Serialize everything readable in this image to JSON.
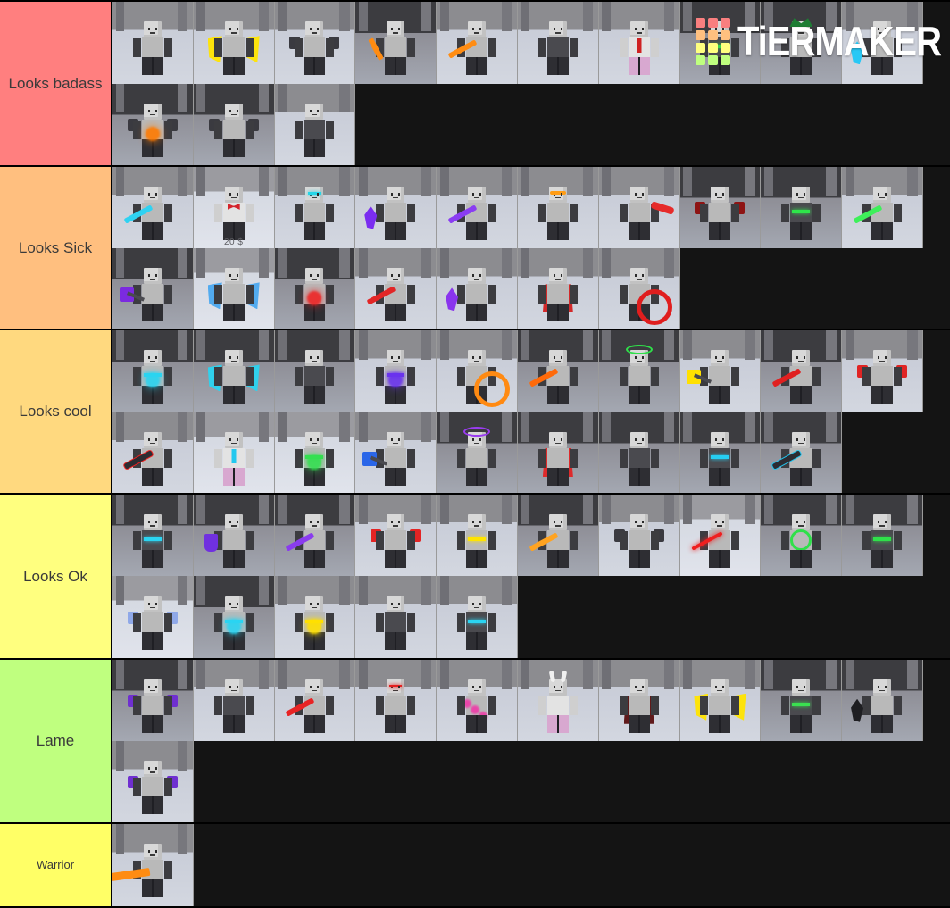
{
  "app": {
    "name": "TierMaker",
    "watermark_text": "TiERMAKER",
    "watermark_colors": [
      "#f97f7f",
      "#f97f7f",
      "#f97f7f",
      "#ffc07f",
      "#ffc07f",
      "#ffc07f",
      "#ffff7f",
      "#ffff7f",
      "#ffff7f",
      "#bfff7f",
      "#bfff7f",
      "#bfff7f"
    ]
  },
  "tiers": [
    {
      "label": "Looks badass",
      "color": "#ff7f7f",
      "count": 13,
      "items": [
        {
          "name": "gray-bot-with-dark-blaster",
          "accent": "#f2d000",
          "scene": "normal",
          "style": "blaster"
        },
        {
          "name": "yellow-energy-wings-bot",
          "accent": "#ffe400",
          "scene": "normal",
          "style": "wings"
        },
        {
          "name": "dark-armor-bot-yellow-gem",
          "accent": "#ffd400",
          "scene": "normal",
          "style": "shoulders"
        },
        {
          "name": "orange-arrow-slash-bot",
          "accent": "#ff8c12",
          "scene": "dark",
          "style": "slash"
        },
        {
          "name": "orange-blade-dark-bot",
          "accent": "#ff8c12",
          "scene": "normal",
          "style": "blade"
        },
        {
          "name": "plain-dark-armor-bot",
          "accent": "#6b6b72",
          "scene": "normal",
          "style": "plain"
        },
        {
          "name": "red-tie-suit-bot",
          "accent": "#cf2222",
          "scene": "normal",
          "style": "tie"
        },
        {
          "name": "green-trim-armor-bot",
          "accent": "#35d34a",
          "scene": "dark",
          "style": "trim"
        },
        {
          "name": "green-leaf-helm-bot",
          "accent": "#1e7d34",
          "scene": "dark",
          "style": "helm"
        },
        {
          "name": "cyan-crystal-bot",
          "accent": "#29c8f5",
          "scene": "normal",
          "style": "shard"
        },
        {
          "name": "orange-core-mech-bot",
          "accent": "#ff7a00",
          "scene": "dark",
          "style": "core"
        },
        {
          "name": "white-green-mech-bot",
          "accent": "#3ee35a",
          "scene": "dark",
          "style": "mech"
        },
        {
          "name": "gray-block-armor-bot",
          "accent": "#8b8b92",
          "scene": "normal",
          "style": "plain"
        }
      ]
    },
    {
      "label": "Looks Sick",
      "color": "#ffbf7f",
      "count": 17,
      "items": [
        {
          "name": "cyan-blade-bot",
          "accent": "#2fd2f2",
          "scene": "normal",
          "style": "blade"
        },
        {
          "name": "red-bowtie-butler-bot",
          "accent": "#d4232b",
          "scene": "bright",
          "style": "bowtie",
          "price": "20 $"
        },
        {
          "name": "cyan-eye-mech-bot",
          "accent": "#23d6e8",
          "scene": "normal",
          "style": "eyes"
        },
        {
          "name": "purple-gauntlet-bot",
          "accent": "#7a2df0",
          "scene": "normal",
          "style": "gauntlet"
        },
        {
          "name": "purple-blade-bot",
          "accent": "#8a3df2",
          "scene": "normal",
          "style": "blade"
        },
        {
          "name": "orange-visor-bot",
          "accent": "#ff9c14",
          "scene": "normal",
          "style": "visor"
        },
        {
          "name": "red-ribbon-mech-bot",
          "accent": "#e62b2b",
          "scene": "normal",
          "style": "ribbon"
        },
        {
          "name": "dark-red-armor-bot",
          "accent": "#8e1414",
          "scene": "dark",
          "style": "armor"
        },
        {
          "name": "green-trim-bot",
          "accent": "#2ee64a",
          "scene": "dark",
          "style": "trim"
        },
        {
          "name": "green-sword-bot",
          "accent": "#3ef05a",
          "scene": "normal",
          "style": "blade"
        },
        {
          "name": "purple-axe-bot",
          "accent": "#7b2ae0",
          "scene": "dark",
          "style": "axe"
        },
        {
          "name": "blue-energy-wings-bot",
          "accent": "#4ba8ef",
          "scene": "bright",
          "style": "wings"
        },
        {
          "name": "red-lightning-bot",
          "accent": "#ef2424",
          "scene": "dark",
          "style": "bolt"
        },
        {
          "name": "red-blade-bot",
          "accent": "#e22626",
          "scene": "normal",
          "style": "blade"
        },
        {
          "name": "purple-claw-bot",
          "accent": "#8a34ee",
          "scene": "normal",
          "style": "claw"
        },
        {
          "name": "red-cape-bot",
          "accent": "#d32020",
          "scene": "normal",
          "style": "cape"
        },
        {
          "name": "red-ring-bot",
          "accent": "#e01e1e",
          "scene": "normal",
          "style": "ring"
        }
      ]
    },
    {
      "label": "Looks cool",
      "color": "#ffd97f",
      "count": 19,
      "items": [
        {
          "name": "cyan-glow-armor-bot",
          "accent": "#2ad4f0",
          "scene": "dark",
          "style": "glow"
        },
        {
          "name": "cyan-wing-blade-bot",
          "accent": "#2ad4f0",
          "scene": "dark",
          "style": "wings"
        },
        {
          "name": "dark-plate-bot",
          "accent": "#5a5a62",
          "scene": "dark",
          "style": "plain"
        },
        {
          "name": "purple-energy-bot",
          "accent": "#6a33ee",
          "scene": "normal",
          "style": "glow"
        },
        {
          "name": "orange-ring-bot",
          "accent": "#ff8a12",
          "scene": "normal",
          "style": "ring"
        },
        {
          "name": "orange-flame-blade-bot",
          "accent": "#ff6a0a",
          "scene": "dark",
          "style": "blade"
        },
        {
          "name": "green-halo-rifle-bot",
          "accent": "#2fe04a",
          "scene": "dark",
          "style": "halo"
        },
        {
          "name": "yellow-hammer-bot",
          "accent": "#ffe000",
          "scene": "normal",
          "style": "hammer"
        },
        {
          "name": "red-blade-cape-bot",
          "accent": "#e02020",
          "scene": "dark",
          "style": "blade"
        },
        {
          "name": "red-shoulder-bot",
          "accent": "#e02424",
          "scene": "normal",
          "style": "armor"
        },
        {
          "name": "red-rifle-bot",
          "accent": "#f02020",
          "scene": "normal",
          "style": "rifle"
        },
        {
          "name": "cyan-tie-suit-bot",
          "accent": "#23c8ef",
          "scene": "bright",
          "style": "tie"
        },
        {
          "name": "green-glow-bot",
          "accent": "#34e050",
          "scene": "bright",
          "style": "glow"
        },
        {
          "name": "blue-axe-bot",
          "accent": "#2a66e8",
          "scene": "normal",
          "style": "axe"
        },
        {
          "name": "purple-crown-bot",
          "accent": "#9a3cf0",
          "scene": "dark",
          "style": "crown"
        },
        {
          "name": "red-banner-bot",
          "accent": "#e22424",
          "scene": "dark",
          "style": "cape"
        },
        {
          "name": "gray-heavy-armor-bot",
          "accent": "#7a7a82",
          "scene": "dark",
          "style": "plain"
        },
        {
          "name": "cyan-trim-armor-bot",
          "accent": "#26cdf2",
          "scene": "dark",
          "style": "trim"
        },
        {
          "name": "cyan-cannon-bot",
          "accent": "#22c4ee",
          "scene": "dark",
          "style": "rifle"
        }
      ]
    },
    {
      "label": "Looks Ok",
      "color": "#ffff7f",
      "count": 15,
      "items": [
        {
          "name": "cyan-stripe-bot",
          "accent": "#2bd4f2",
          "scene": "dark",
          "style": "trim"
        },
        {
          "name": "purple-shield-bot",
          "accent": "#7030e0",
          "scene": "dark",
          "style": "shield"
        },
        {
          "name": "purple-small-blade-bot",
          "accent": "#8a3cee",
          "scene": "dark",
          "style": "blade"
        },
        {
          "name": "red-arm-bot",
          "accent": "#e42424",
          "scene": "normal",
          "style": "armor"
        },
        {
          "name": "yellow-chest-bot",
          "accent": "#ffe400",
          "scene": "normal",
          "style": "chest"
        },
        {
          "name": "orange-blade-gray-bot",
          "accent": "#ffa320",
          "scene": "dark",
          "style": "blade"
        },
        {
          "name": "yellow-red-mech-bot",
          "accent": "#ffe000",
          "scene": "normal",
          "style": "mech"
        },
        {
          "name": "red-beam-sword-bot",
          "accent": "#ef1f1f",
          "scene": "bright",
          "style": "beam"
        },
        {
          "name": "green-cross-bot",
          "accent": "#2fe04a",
          "scene": "dark",
          "style": "cross"
        },
        {
          "name": "green-trim-dark-bot",
          "accent": "#2fe04a",
          "scene": "dark",
          "style": "trim"
        },
        {
          "name": "blue-white-armor-bot",
          "accent": "#8fa8e8",
          "scene": "bright",
          "style": "armor"
        },
        {
          "name": "cyan-burst-bot",
          "accent": "#2ad4f2",
          "scene": "dark",
          "style": "glow"
        },
        {
          "name": "yellow-glow-bot",
          "accent": "#ffe000",
          "scene": "normal",
          "style": "glow"
        },
        {
          "name": "gray-plain-bot",
          "accent": "#9a9aa2",
          "scene": "normal",
          "style": "plain"
        },
        {
          "name": "cyan-edge-bot",
          "accent": "#2ad4f2",
          "scene": "normal",
          "style": "trim"
        }
      ]
    },
    {
      "label": "Lame",
      "color": "#bfff7f",
      "count": 11,
      "items": [
        {
          "name": "purple-armor-bot",
          "accent": "#6f2fd0",
          "scene": "dark",
          "style": "armor"
        },
        {
          "name": "gray-yellow-dot-bot",
          "accent": "#ffe000",
          "scene": "normal",
          "style": "plain"
        },
        {
          "name": "red-sliver-bot",
          "accent": "#e82424",
          "scene": "normal",
          "style": "blade"
        },
        {
          "name": "red-eyes-dark-bot",
          "accent": "#e42020",
          "scene": "normal",
          "style": "eyes"
        },
        {
          "name": "pink-purple-bubble-bot",
          "accent": "#ef3aa8",
          "scene": "normal",
          "style": "bubbles"
        },
        {
          "name": "pink-bunny-bot",
          "accent": "#f078c8",
          "scene": "normal",
          "style": "bunny"
        },
        {
          "name": "maroon-red-eye-bot",
          "accent": "#5a1010",
          "scene": "normal",
          "style": "cape"
        },
        {
          "name": "yellow-wing-bot",
          "accent": "#ffe400",
          "scene": "normal",
          "style": "wings"
        },
        {
          "name": "green-dark-bot",
          "accent": "#3ae050",
          "scene": "dark",
          "style": "trim"
        },
        {
          "name": "black-hook-bot",
          "accent": "#1e1e22",
          "scene": "dark",
          "style": "claw"
        },
        {
          "name": "purple-tank-bot",
          "accent": "#6f2fd0",
          "scene": "normal",
          "style": "armor"
        }
      ]
    },
    {
      "label": "Warrior",
      "color": "#ffff66",
      "count": 1,
      "items": [
        {
          "name": "orange-greatsword-bot",
          "accent": "#ff8c12",
          "scene": "normal",
          "style": "greatsword"
        }
      ]
    }
  ]
}
